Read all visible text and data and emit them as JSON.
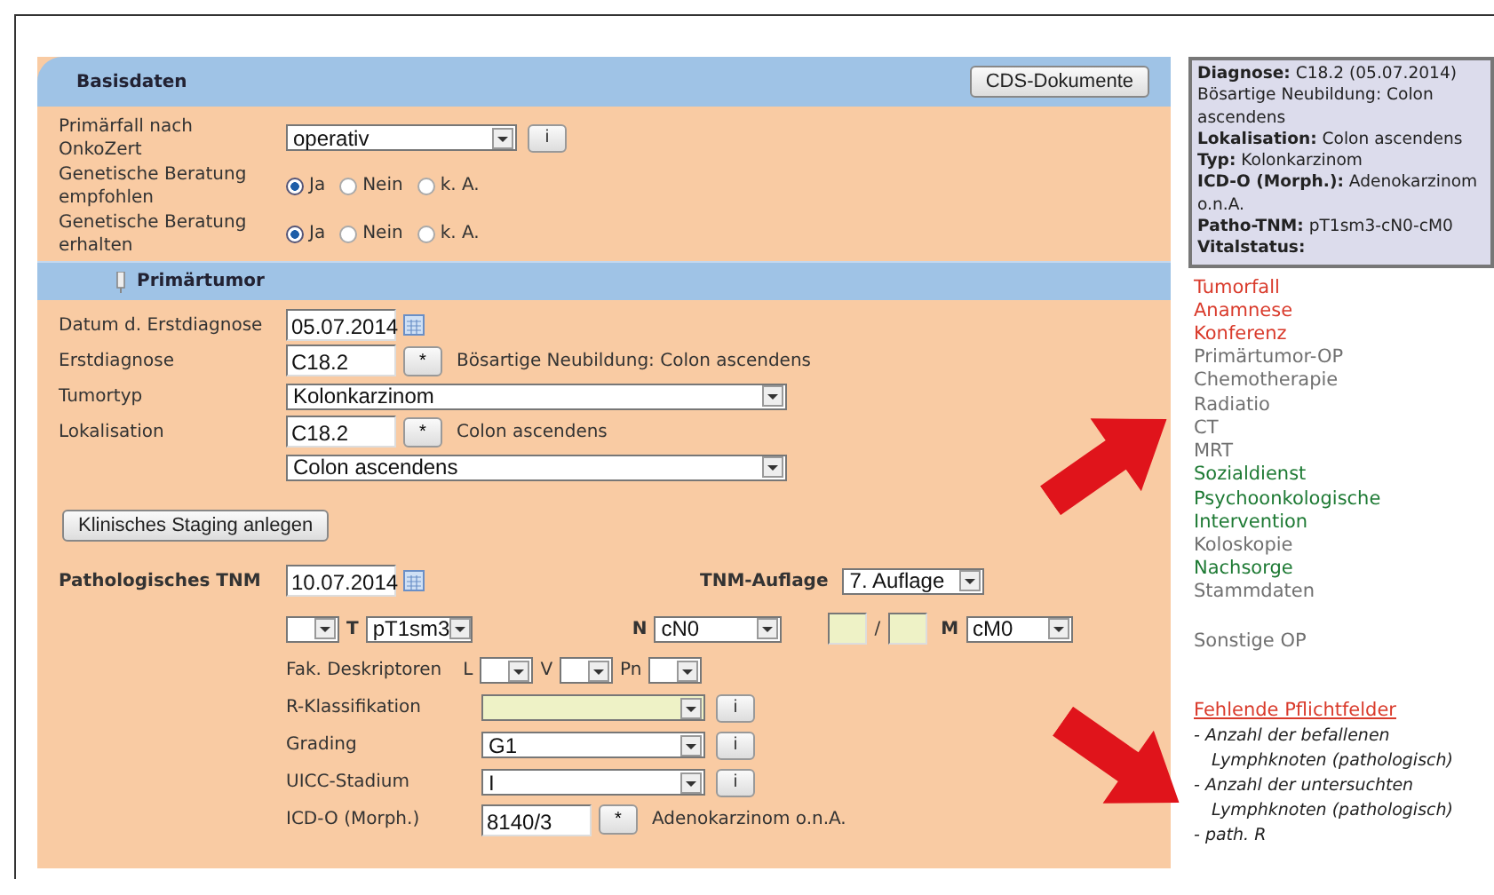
{
  "basisdaten": {
    "title": "Basisdaten",
    "button": "CDS-Dokumente",
    "fields": [
      {
        "label": "Primärfall nach OnkoZert",
        "kind": "select",
        "value": "operativ",
        "info": "i"
      },
      {
        "label": "Genetische Beratung empfohlen",
        "kind": "radio",
        "options": [
          {
            "label": "Ja",
            "selected": true
          },
          {
            "label": "Nein",
            "selected": false
          },
          {
            "label": "k. A.",
            "selected": false
          }
        ]
      },
      {
        "label": "Genetische Beratung erhalten",
        "kind": "radio",
        "options": [
          {
            "label": "Ja",
            "selected": true
          },
          {
            "label": "Nein",
            "selected": false
          },
          {
            "label": "k. A.",
            "selected": false
          }
        ]
      }
    ]
  },
  "primaertumor": {
    "title": "Primärtumor",
    "fields": [
      {
        "label": "Datum d. Erstdiagnose",
        "kind": "date",
        "value": "05.07.2014"
      },
      {
        "label": "Erstdiagnose",
        "kind": "code",
        "value": "C18.2",
        "button": "*",
        "text": "Bösartige Neubildung: Colon ascendens"
      },
      {
        "label": "Tumortyp",
        "kind": "wide_select",
        "value": "Kolonkarzinom"
      },
      {
        "label": "Lokalisation",
        "kind": "code",
        "value": "C18.2",
        "button": "*",
        "text": "Colon ascendens"
      },
      {
        "kind": "wide_select",
        "value": "Colon ascendens"
      }
    ],
    "staging_button": "Klinisches Staging anlegen",
    "tnm": {
      "label": "Pathologisches TNM",
      "date": "10.07.2014",
      "edition_label": "TNM-Auflage",
      "edition": "7. Auflage",
      "t_label": "T",
      "t": "pT1sm3",
      "n_label": "N",
      "n": "cN0",
      "lymph_fields": [
        {
          "highlighted": true
        },
        {
          "highlighted": true
        }
      ],
      "separator": "/",
      "m_label": "M",
      "m": "cM0",
      "descriptors": {
        "label": "Fak. Deskriptoren",
        "items": [
          {
            "letter": "L"
          },
          {
            "letter": "V"
          },
          {
            "letter": "Pn"
          }
        ]
      }
    },
    "details": [
      {
        "label": "R-Klassifikation",
        "kind": "select",
        "highlighted": true,
        "info": "i"
      },
      {
        "label": "Grading",
        "kind": "select",
        "value": "G1",
        "highlighted": false,
        "info": "i"
      },
      {
        "label": "UICC-Stadium",
        "kind": "select",
        "value": "I",
        "highlighted": false,
        "info": "i"
      },
      {
        "label": "ICD-O (Morph.)",
        "kind": "code",
        "value": "8140/3",
        "button": "*",
        "text": "Adenokarzinom o.n.A."
      }
    ]
  },
  "summary": [
    {
      "label": "Diagnose:",
      "value": "C18.2 (05.07.2014) Bösartige Neubildung: Colon ascendens"
    },
    {
      "label": "Lokalisation:",
      "value": "Colon ascendens"
    },
    {
      "label": "Typ:",
      "value": "Kolonkarzinom"
    },
    {
      "label": "ICD-O (Morph.):",
      "value": "Adenokarzinom o.n.A."
    },
    {
      "label": "Patho-TNM:",
      "value": "pT1sm3-cN0-cM0"
    },
    {
      "label": "Vitalstatus:"
    }
  ],
  "nav_groups": [
    {
      "items": [
        {
          "label": "Tumorfall",
          "color": "#d93a2b"
        },
        {
          "label": "Anamnese",
          "color": "#d93a2b"
        },
        {
          "label": "Konferenz",
          "color": "#d93a2b"
        },
        {
          "label": "Primärtumor-OP",
          "color": "#707070"
        },
        {
          "label": "Chemotherapie",
          "color": "#707070"
        },
        {
          "label": "Radiatio",
          "color": "#707070"
        },
        {
          "label": "CT",
          "color": "#707070"
        },
        {
          "label": "MRT",
          "color": "#707070"
        },
        {
          "label": "Sozialdienst",
          "color": "#1e7a34"
        },
        {
          "label": "Psychoonkologische Intervention",
          "color": "#1e7a34"
        },
        {
          "label": "Koloskopie",
          "color": "#707070"
        },
        {
          "label": "Nachsorge",
          "color": "#1e7a34"
        },
        {
          "label": "Stammdaten",
          "color": "#707070"
        }
      ]
    },
    {
      "items": [
        {
          "label": "Sonstige OP",
          "color": "#707070"
        }
      ]
    }
  ],
  "missing": {
    "title": "Fehlende Pflichtfelder",
    "items": [
      "- Anzahl der befallenen Lymphknoten (pathologisch)",
      "- Anzahl der untersuchten Lymphknoten (pathologisch)",
      "- path. R"
    ]
  }
}
